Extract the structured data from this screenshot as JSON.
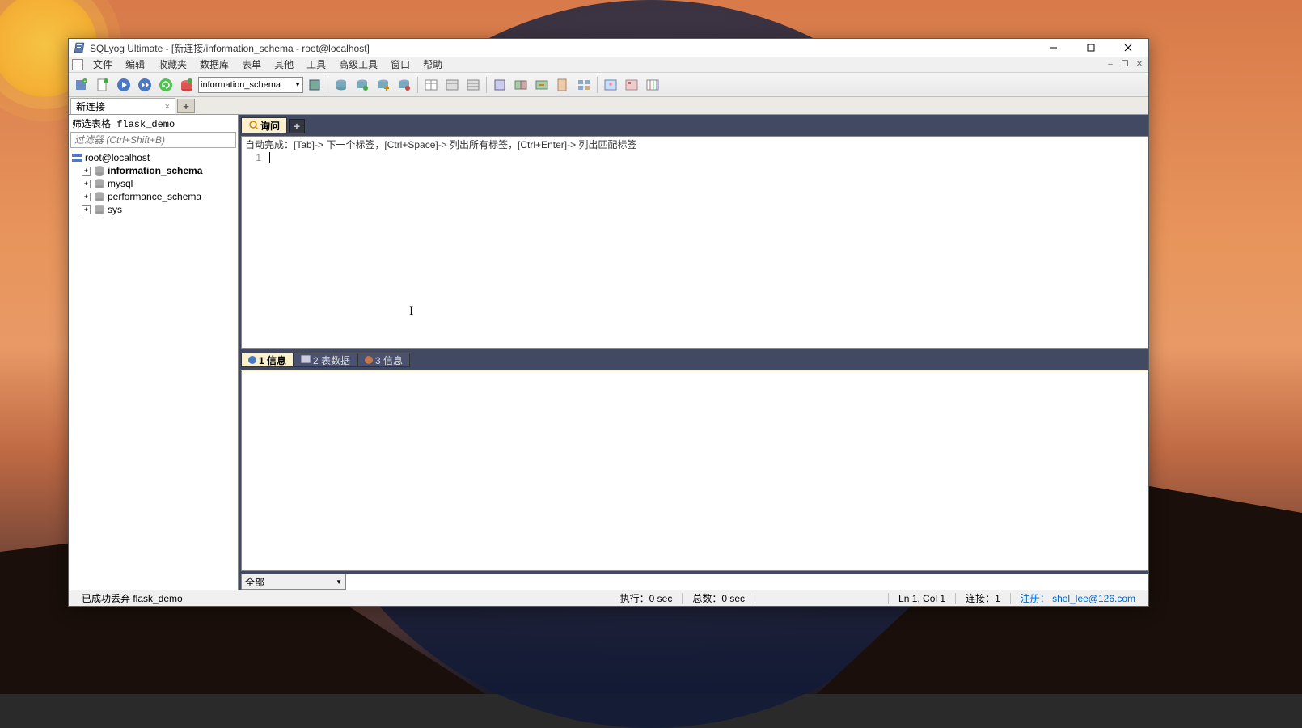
{
  "titlebar": {
    "text": "SQLyog Ultimate - [新连接/information_schema - root@localhost]"
  },
  "menu": {
    "items": [
      "文件",
      "编辑",
      "收藏夹",
      "数据库",
      "表单",
      "其他",
      "工具",
      "高级工具",
      "窗口",
      "帮助"
    ]
  },
  "toolbar": {
    "db_selected": "information_schema"
  },
  "conn_tabs": {
    "tab": "新连接"
  },
  "left": {
    "filter_label": "筛选表格 flask_demo",
    "filter_placeholder": "过滤器 (Ctrl+Shift+B)",
    "root": "root@localhost",
    "dbs": [
      "information_schema",
      "mysql",
      "performance_schema",
      "sys"
    ]
  },
  "query": {
    "tab": "询问",
    "hint": "自动完成：[Tab]-> 下一个标签，[Ctrl+Space]-> 列出所有标签，[Ctrl+Enter]-> 列出匹配标签",
    "line1": "1"
  },
  "results": {
    "tab1": "1 信息",
    "tab2": "2 表数据",
    "tab3": "3 信息"
  },
  "bottom_combo": "全部",
  "status": {
    "msg": "已成功丢弃 flask_demo",
    "exec": "执行：0 sec",
    "total": "总数：0 sec",
    "pos": "Ln 1, Col 1",
    "conn": "连接：1",
    "reg": "注册： shel_lee@126.com"
  }
}
